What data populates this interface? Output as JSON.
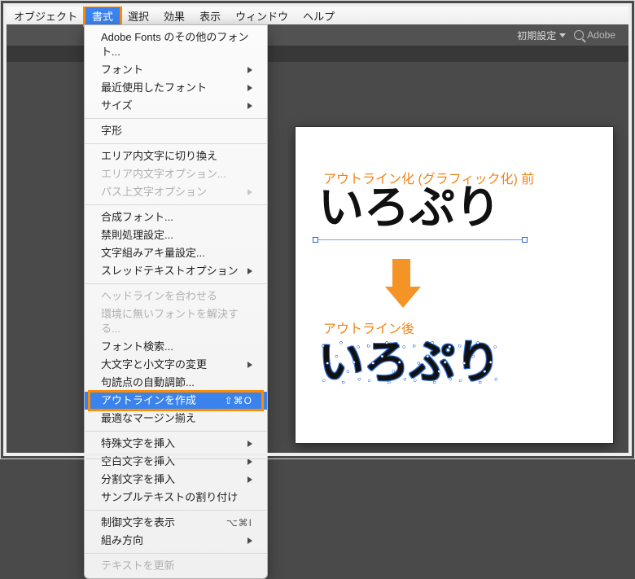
{
  "menubar": {
    "items": [
      {
        "label": "オブジェクト"
      },
      {
        "label": "書式"
      },
      {
        "label": "選択"
      },
      {
        "label": "効果"
      },
      {
        "label": "表示"
      },
      {
        "label": "ウィンドウ"
      },
      {
        "label": "ヘルプ"
      }
    ]
  },
  "toolbar": {
    "preset_label": "初期設定",
    "search_placeholder": "Adobe"
  },
  "dropdown": {
    "items": [
      {
        "label": "Adobe Fonts のその他のフォント...",
        "submenu": false
      },
      {
        "label": "フォント",
        "submenu": true
      },
      {
        "label": "最近使用したフォント",
        "submenu": true
      },
      {
        "label": "サイズ",
        "submenu": true
      },
      {
        "sep": true
      },
      {
        "label": "字形",
        "submenu": false
      },
      {
        "sep": true
      },
      {
        "label": "エリア内文字に切り換え",
        "submenu": false
      },
      {
        "label": "エリア内文字オプション...",
        "submenu": false,
        "disabled": true
      },
      {
        "label": "パス上文字オプション",
        "submenu": true,
        "disabled": true
      },
      {
        "sep": true
      },
      {
        "label": "合成フォント...",
        "submenu": false
      },
      {
        "label": "禁則処理設定...",
        "submenu": false
      },
      {
        "label": "文字組みアキ量設定...",
        "submenu": false
      },
      {
        "label": "スレッドテキストオプション",
        "submenu": true
      },
      {
        "sep": true
      },
      {
        "label": "ヘッドラインを合わせる",
        "submenu": false,
        "disabled": true
      },
      {
        "label": "環境に無いフォントを解決する...",
        "submenu": false,
        "disabled": true
      },
      {
        "label": "フォント検索...",
        "submenu": false
      },
      {
        "label": "大文字と小文字の変更",
        "submenu": true
      },
      {
        "label": "句読点の自動調節...",
        "submenu": false
      },
      {
        "label": "アウトラインを作成",
        "submenu": false,
        "selected": true,
        "highlighted": true,
        "shortcut": "⇧⌘O"
      },
      {
        "label": "最適なマージン揃え",
        "submenu": false
      },
      {
        "sep": true
      },
      {
        "label": "特殊文字を挿入",
        "submenu": true
      },
      {
        "label": "空白文字を挿入",
        "submenu": true
      },
      {
        "label": "分割文字を挿入",
        "submenu": true
      },
      {
        "label": "サンプルテキストの割り付け",
        "submenu": false
      },
      {
        "sep": true
      },
      {
        "label": "制御文字を表示",
        "shortcut": "⌥⌘I"
      },
      {
        "label": "組み方向",
        "submenu": true
      },
      {
        "sep": true
      },
      {
        "label": "テキストを更新",
        "disabled": true
      }
    ]
  },
  "canvas": {
    "label_before": "アウトライン化 (グラフィック化) 前",
    "label_after": "アウトライン後",
    "sample_text": "いろぷり"
  }
}
